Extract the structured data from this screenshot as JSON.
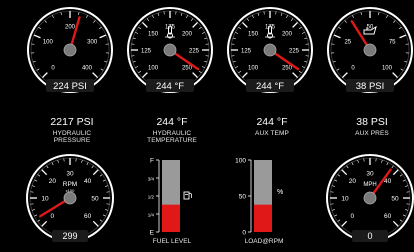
{
  "colors": {
    "needle": "#e01818",
    "track": "#9a9a9a",
    "fill_red": "#e01818",
    "background": "#000000"
  },
  "gauges": [
    {
      "name": "hydraulic-pressure-gauge",
      "ticks": [
        "0",
        "100",
        "200",
        "300",
        "400"
      ],
      "readout": "224 PSI",
      "icon": "none",
      "needle_value": 224,
      "min": 0,
      "max": 400
    },
    {
      "name": "hydraulic-temperature-gauge",
      "ticks": [
        "100",
        "125",
        "150",
        "175",
        "200",
        "225",
        "250"
      ],
      "readout": "244 °F",
      "icon": "thermometer-icon",
      "needle_value": 244,
      "min": 100,
      "max": 250
    },
    {
      "name": "aux-temp-gauge",
      "ticks": [
        "100",
        "125",
        "150",
        "175",
        "200",
        "225",
        "250"
      ],
      "readout": "244 °F",
      "icon": "thermometer-icon",
      "needle_value": 244,
      "min": 100,
      "max": 250
    },
    {
      "name": "aux-pressure-gauge",
      "ticks": [
        "0",
        "25",
        "50",
        "75",
        "100"
      ],
      "readout": "38 PSI",
      "icon": "oil-can-icon",
      "needle_value": 38,
      "min": 0,
      "max": 100
    }
  ],
  "readings": [
    {
      "value": "2217 PSI",
      "label": "HYDRAULIC\nPRESSURE"
    },
    {
      "value": "244 °F",
      "label": "HYDRAULIC\nTEMPERATURE"
    },
    {
      "value": "244 °F",
      "label": "AUX TEMP"
    },
    {
      "value": "38 PSI",
      "label": "AUX PRES"
    }
  ],
  "rpm_gauge": {
    "ticks": [
      "0",
      "10",
      "20",
      "30",
      "40",
      "50",
      "60"
    ],
    "unit": "RPM",
    "sub": "x100",
    "readout": "299",
    "needle_value": 3,
    "min": 0,
    "max": 60
  },
  "mph_gauge": {
    "ticks": [
      "0",
      "10",
      "20",
      "30",
      "40",
      "50",
      "60"
    ],
    "unit": "MPH",
    "readout": "0",
    "needle_value": 38,
    "min": 0,
    "max": 60
  },
  "fuel_level": {
    "label": "FUEL LEVEL",
    "top_mark": "F",
    "bottom_mark": "E",
    "ticks": [
      "3/4",
      "1/2",
      "1/4"
    ],
    "level": 0.38,
    "icon": "fuel-pump-icon"
  },
  "load_rpm": {
    "label": "LOAD@RPM",
    "ticks": [
      "100",
      "50",
      "0"
    ],
    "unit": "%",
    "level": 0.38
  }
}
